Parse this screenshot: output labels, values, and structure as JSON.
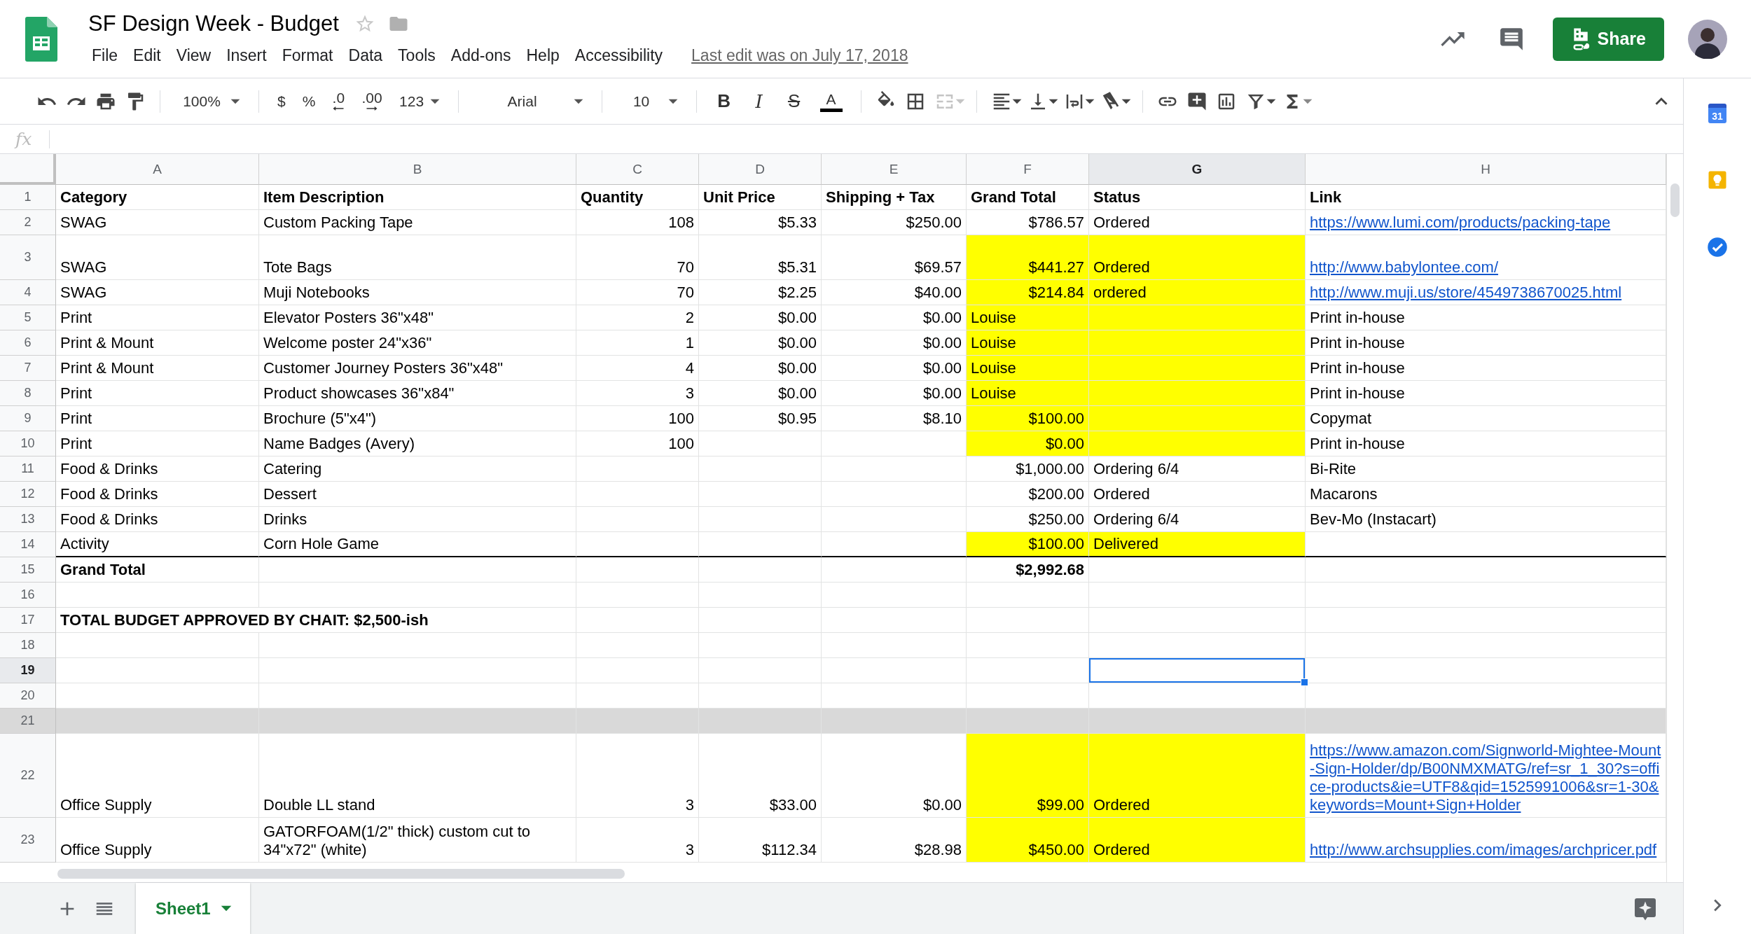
{
  "document": {
    "title": "SF Design Week - Budget",
    "starred": false,
    "last_edit": "Last edit was on July 17, 2018"
  },
  "menu": [
    "File",
    "Edit",
    "View",
    "Insert",
    "Format",
    "Data",
    "Tools",
    "Add-ons",
    "Help",
    "Accessibility"
  ],
  "share_button": "Share",
  "toolbar": {
    "zoom": "100%",
    "currency": "$",
    "percent": "%",
    "decrease_decimals": ".0",
    "increase_decimals": ".00",
    "more_formats": "123",
    "font": "Arial",
    "font_size": "10",
    "bold": "B",
    "italic": "I",
    "strikethrough": "S",
    "text_color": "A",
    "merge_disabled": true
  },
  "formula_bar": {
    "label": "fx"
  },
  "columns": [
    {
      "label": "A",
      "selected": false
    },
    {
      "label": "B",
      "selected": false
    },
    {
      "label": "C",
      "selected": false
    },
    {
      "label": "D",
      "selected": false
    },
    {
      "label": "E",
      "selected": false
    },
    {
      "label": "F",
      "selected": false
    },
    {
      "label": "G",
      "selected": true
    },
    {
      "label": "H",
      "selected": false
    }
  ],
  "rows": [
    {
      "number": "1",
      "selected": false,
      "bold": true,
      "cells": [
        {
          "text": "Category"
        },
        {
          "text": "Item Description"
        },
        {
          "text": "Quantity"
        },
        {
          "text": "Unit Price"
        },
        {
          "text": "Shipping + Tax"
        },
        {
          "text": "Grand Total"
        },
        {
          "text": "Status"
        },
        {
          "text": "Link"
        }
      ]
    },
    {
      "number": "2",
      "selected": false,
      "cells": [
        {
          "text": "SWAG"
        },
        {
          "text": "Custom Packing Tape"
        },
        {
          "text": "108",
          "kind": "number"
        },
        {
          "text": "$5.33",
          "kind": "number"
        },
        {
          "text": "$250.00",
          "kind": "number"
        },
        {
          "text": "$786.57",
          "kind": "number"
        },
        {
          "text": "Ordered"
        },
        {
          "text": "https://www.lumi.com/products/packing-tape",
          "kind": "link"
        }
      ]
    },
    {
      "number": "3",
      "selected": false,
      "cells": [
        {
          "text": "SWAG"
        },
        {
          "text": "Tote Bags"
        },
        {
          "text": "70",
          "kind": "number"
        },
        {
          "text": "$5.31",
          "kind": "number"
        },
        {
          "text": "$69.57",
          "kind": "number"
        },
        {
          "text": "$441.27",
          "kind": "number",
          "color": "#ffff00"
        },
        {
          "text": "Ordered",
          "color": "#ffff00"
        },
        {
          "text": "http://www.babylontee.com/",
          "kind": "link"
        }
      ]
    },
    {
      "number": "4",
      "selected": false,
      "cells": [
        {
          "text": "SWAG"
        },
        {
          "text": "Muji Notebooks"
        },
        {
          "text": "70",
          "kind": "number"
        },
        {
          "text": "$2.25",
          "kind": "number"
        },
        {
          "text": "$40.00",
          "kind": "number"
        },
        {
          "text": "$214.84",
          "kind": "number",
          "color": "#ffff00"
        },
        {
          "text": "ordered",
          "color": "#ffff00"
        },
        {
          "text": "http://www.muji.us/store/4549738670025.html",
          "kind": "link"
        }
      ]
    },
    {
      "number": "5",
      "selected": false,
      "cells": [
        {
          "text": "Print"
        },
        {
          "text": "Elevator Posters 36\"x48\""
        },
        {
          "text": "2",
          "kind": "number"
        },
        {
          "text": "$0.00",
          "kind": "number"
        },
        {
          "text": "$0.00",
          "kind": "number"
        },
        {
          "text": "Louise",
          "color": "#ffff00"
        },
        {
          "color": "#ffff00"
        },
        {
          "text": "Print in-house"
        }
      ]
    },
    {
      "number": "6",
      "selected": false,
      "cells": [
        {
          "text": "Print & Mount"
        },
        {
          "text": "Welcome poster 24\"x36\""
        },
        {
          "text": "1",
          "kind": "number"
        },
        {
          "text": "$0.00",
          "kind": "number"
        },
        {
          "text": "$0.00",
          "kind": "number"
        },
        {
          "text": "Louise",
          "color": "#ffff00"
        },
        {
          "color": "#ffff00"
        },
        {
          "text": "Print in-house"
        }
      ]
    },
    {
      "number": "7",
      "selected": false,
      "cells": [
        {
          "text": "Print & Mount"
        },
        {
          "text": "Customer Journey Posters 36\"x48\""
        },
        {
          "text": "4",
          "kind": "number"
        },
        {
          "text": "$0.00",
          "kind": "number"
        },
        {
          "text": "$0.00",
          "kind": "number"
        },
        {
          "text": "Louise",
          "color": "#ffff00"
        },
        {
          "color": "#ffff00"
        },
        {
          "text": "Print in-house"
        }
      ]
    },
    {
      "number": "8",
      "selected": false,
      "cells": [
        {
          "text": "Print"
        },
        {
          "text": "Product showcases 36\"x84\""
        },
        {
          "text": "3",
          "kind": "number"
        },
        {
          "text": "$0.00",
          "kind": "number"
        },
        {
          "text": "$0.00",
          "kind": "number"
        },
        {
          "text": "Louise",
          "color": "#ffff00"
        },
        {
          "color": "#ffff00"
        },
        {
          "text": "Print in-house"
        }
      ]
    },
    {
      "number": "9",
      "selected": false,
      "cells": [
        {
          "text": "Print"
        },
        {
          "text": "Brochure (5\"x4\")"
        },
        {
          "text": "100",
          "kind": "number"
        },
        {
          "text": "$0.95",
          "kind": "number"
        },
        {
          "text": "$8.10",
          "kind": "number"
        },
        {
          "text": "$100.00",
          "kind": "number",
          "color": "#ffff00"
        },
        {
          "color": "#ffff00"
        },
        {
          "text": "Copymat"
        }
      ]
    },
    {
      "number": "10",
      "selected": false,
      "cells": [
        {
          "text": "Print"
        },
        {
          "text": "Name Badges (Avery)"
        },
        {
          "text": "100",
          "kind": "number"
        },
        {},
        {},
        {
          "text": "$0.00",
          "kind": "number",
          "color": "#ffff00"
        },
        {
          "color": "#ffff00"
        },
        {
          "text": "Print in-house"
        }
      ]
    },
    {
      "number": "11",
      "selected": false,
      "cells": [
        {
          "text": "Food & Drinks"
        },
        {
          "text": "Catering"
        },
        {},
        {},
        {},
        {
          "text": "$1,000.00",
          "kind": "number"
        },
        {
          "text": "Ordering 6/4"
        },
        {
          "text": "Bi-Rite"
        }
      ]
    },
    {
      "number": "12",
      "selected": false,
      "cells": [
        {
          "text": "Food & Drinks"
        },
        {
          "text": "Dessert"
        },
        {},
        {},
        {},
        {
          "text": "$200.00",
          "kind": "number"
        },
        {
          "text": "Ordered"
        },
        {
          "text": "Macarons"
        }
      ]
    },
    {
      "number": "13",
      "selected": false,
      "cells": [
        {
          "text": "Food & Drinks"
        },
        {
          "text": "Drinks"
        },
        {},
        {},
        {},
        {
          "text": "$250.00",
          "kind": "number"
        },
        {
          "text": "Ordering 6/4"
        },
        {
          "text": "Bev-Mo (Instacart)"
        }
      ]
    },
    {
      "number": "14",
      "selected": false,
      "rule_below": true,
      "cells": [
        {
          "text": "Activity"
        },
        {
          "text": "Corn Hole Game"
        },
        {},
        {},
        {},
        {
          "text": "$100.00",
          "kind": "number",
          "color": "#ffff00"
        },
        {
          "text": "Delivered",
          "color": "#ffff00"
        }
      ]
    },
    {
      "number": "15",
      "selected": false,
      "bold": true,
      "cells": [
        {
          "text": "Grand Total"
        },
        {},
        {},
        {},
        {},
        {
          "text": "$2,992.68",
          "kind": "number"
        }
      ]
    },
    {
      "number": "16",
      "selected": false
    },
    {
      "number": "17",
      "selected": false,
      "bold": true,
      "cells": [
        {
          "text": "TOTAL BUDGET APPROVED BY CHAIT: $2,500-ish"
        }
      ]
    },
    {
      "number": "18",
      "selected": false
    },
    {
      "number": "19",
      "selected": true
    },
    {
      "number": "20",
      "selected": false
    },
    {
      "number": "21",
      "selected": false,
      "color": "#d9d9d9"
    },
    {
      "number": "22",
      "selected": false,
      "cells": [
        {
          "text": "Office Supply"
        },
        {
          "text": "Double LL stand"
        },
        {
          "text": "3",
          "kind": "number"
        },
        {
          "text": "$33.00",
          "kind": "number"
        },
        {
          "text": "$0.00",
          "kind": "number"
        },
        {
          "text": "$99.00",
          "kind": "number",
          "color": "#ffff00"
        },
        {
          "text": "Ordered",
          "color": "#ffff00"
        },
        {
          "text": "https://www.amazon.com/Signworld-Mightee-Mount-Sign-Holder/dp/B00NMXMATG/ref=sr_1_30?s=office-products&ie=UTF8&qid=1525991006&sr=1-30&keywords=Mount+Sign+Holder",
          "kind": "link"
        }
      ]
    },
    {
      "number": "23",
      "selected": false,
      "cells": [
        {
          "text": "Office Supply"
        },
        {
          "text": "GATORFOAM(1/2\" thick) custom cut to 34\"x72\" (white)"
        },
        {
          "text": "3",
          "kind": "number"
        },
        {
          "text": "$112.34",
          "kind": "number"
        },
        {
          "text": "$28.98",
          "kind": "number"
        },
        {
          "text": "$450.00",
          "kind": "number",
          "color": "#ffff00"
        },
        {
          "text": "Ordered",
          "color": "#ffff00"
        },
        {
          "text": "http://www.archsupplies.com/images/archpricer.pdf",
          "kind": "link"
        }
      ]
    }
  ],
  "sheets": [
    {
      "name": "Sheet1",
      "selected": true
    }
  ],
  "side_panel": {
    "calendar_day": "31"
  }
}
